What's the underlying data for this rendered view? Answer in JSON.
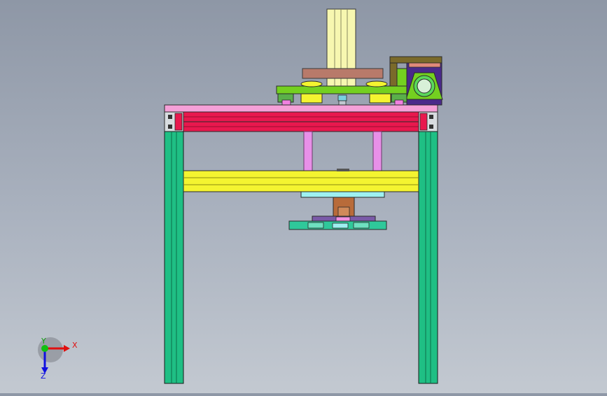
{
  "view": {
    "background_top": "#8e97a6",
    "background_bottom": "#c3c9d1"
  },
  "triad": {
    "x_label": "X",
    "y_label": "Y",
    "z_label": "Z",
    "x_color": "#e01010",
    "y_color": "#10c010",
    "z_color": "#1010e0"
  },
  "parts": {
    "frame_legs": "#1fbf84",
    "top_plate": "#f5a0d8",
    "cross_beams": "#e8184e",
    "middle_beam": "#f4f430",
    "guide_rods": "#e890e8",
    "cylinder_body": "#f7f7b0",
    "motor_bracket": "#74d020",
    "bracket_frame": "#7a6a2a",
    "bearing_housing": "#4a2a8a",
    "stop_plate": "#b87a6a",
    "lower_block": "#b86b3a",
    "tool_plate": "#2fc89a",
    "connector_plate": "#9ef0f0"
  }
}
